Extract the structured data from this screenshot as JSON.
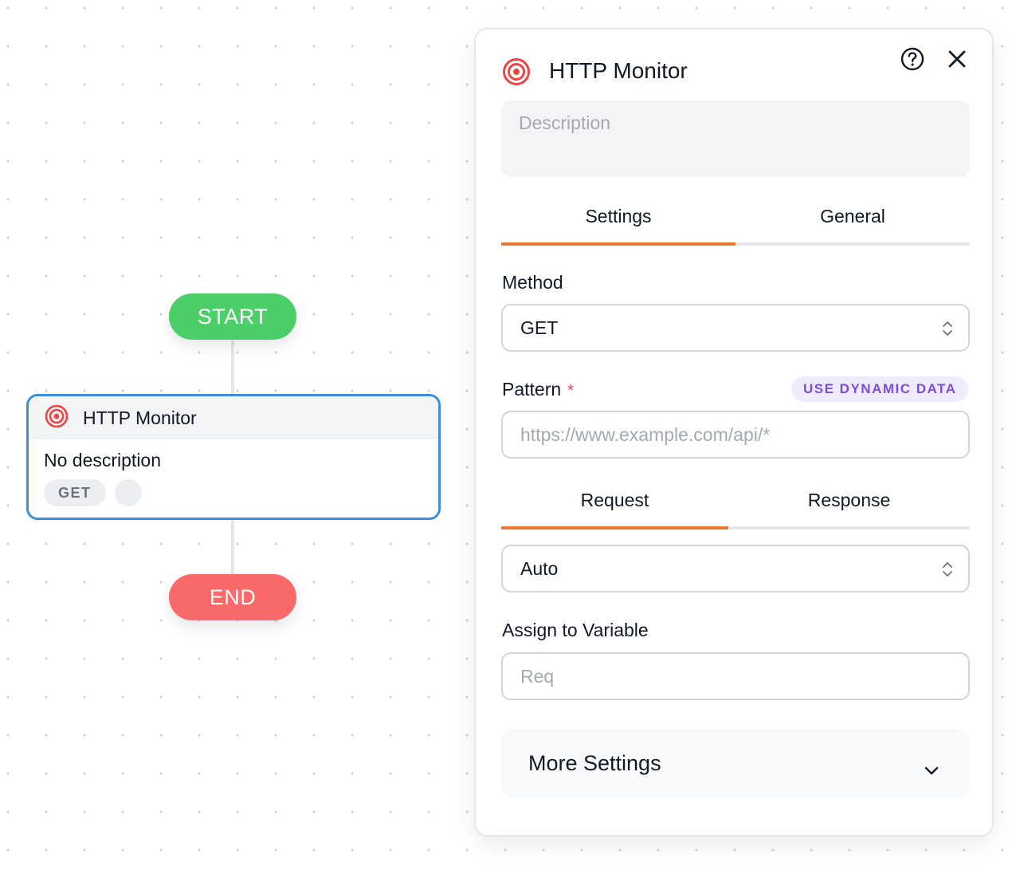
{
  "canvas": {
    "start_label": "START",
    "end_label": "END",
    "node": {
      "title": "HTTP Monitor",
      "description": "No description",
      "method_badge": "GET"
    }
  },
  "panel": {
    "title": "HTTP Monitor",
    "icon": "target-icon",
    "description_placeholder": "Description",
    "tabs": [
      {
        "label": "Settings",
        "active": true
      },
      {
        "label": "General",
        "active": false
      }
    ],
    "method": {
      "label": "Method",
      "value": "GET"
    },
    "pattern": {
      "label": "Pattern",
      "required_mark": "*",
      "dynamic_button": "USE DYNAMIC DATA",
      "placeholder": "https://www.example.com/api/*"
    },
    "sub_tabs": [
      {
        "label": "Request",
        "active": true
      },
      {
        "label": "Response",
        "active": false
      }
    ],
    "body_type": {
      "value": "Auto"
    },
    "assign_variable": {
      "label": "Assign to Variable",
      "placeholder": "Req"
    },
    "more_settings": {
      "label": "More Settings"
    }
  },
  "colors": {
    "start": "#4ccf68",
    "end": "#fa6a6a",
    "node_border": "#3a8ee6",
    "tab_active": "#ea7a2f",
    "dynamic_text": "#7c4ddb",
    "dynamic_bg": "#eeecfc",
    "target_icon": "#ef4444"
  }
}
